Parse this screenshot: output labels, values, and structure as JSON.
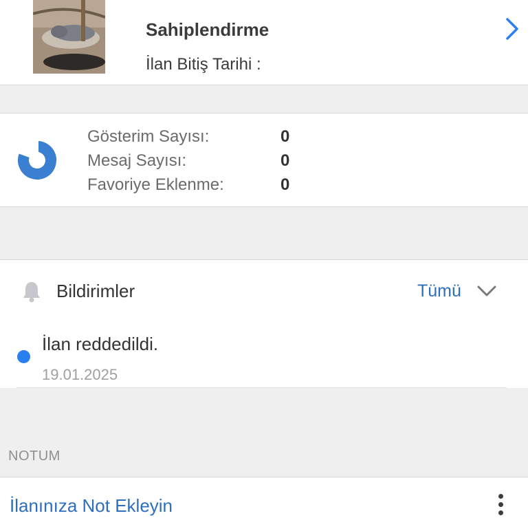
{
  "listing": {
    "title": "Sahiplendirme",
    "end_date_label": "İlan Bitiş Tarihi :",
    "thumbnail": "cat-photo",
    "chevron_icon": "chevron-right-icon"
  },
  "stats": {
    "icon": "pie-chart-icon",
    "items": [
      {
        "label": "Gösterim Sayısı:",
        "value": "0"
      },
      {
        "label": "Mesaj Sayısı:",
        "value": "0"
      },
      {
        "label": "Favoriye Eklenme:",
        "value": "0"
      }
    ]
  },
  "notifications": {
    "icon": "bell-icon",
    "title": "Bildirimler",
    "filter_label": "Tümü",
    "filter_icon": "chevron-down-icon",
    "items": [
      {
        "text": "İlan reddedildi.",
        "date": "19.01.2025",
        "unread": true
      }
    ]
  },
  "notes": {
    "header": "NOTUM",
    "add_label": "İlanınıza Not Ekleyin",
    "menu_icon": "more-vertical-icon"
  },
  "colors": {
    "accent_blue": "#2e6ebf",
    "unread_dot": "#2a7ff0",
    "chart_blue": "#3a7fd0",
    "background": "#efeff0"
  }
}
